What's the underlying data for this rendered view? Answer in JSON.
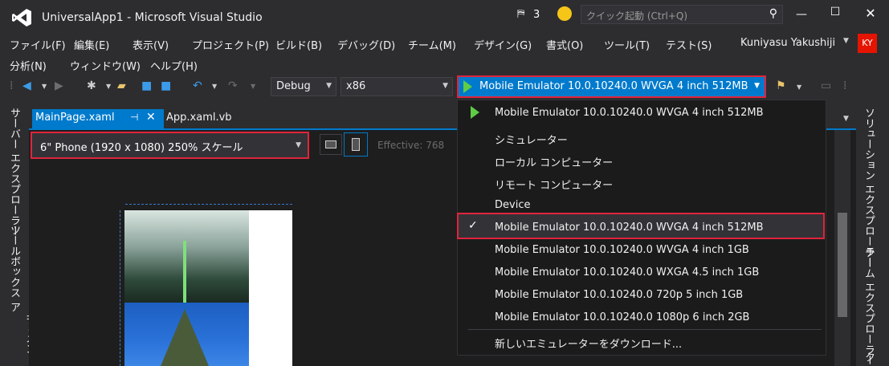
{
  "window": {
    "title": "UniversalApp1 - Microsoft Visual Studio",
    "notification_count": "3",
    "quick_launch_placeholder": "クイック起動 (Ctrl+Q)"
  },
  "menu": {
    "row1": [
      "ファイル(F)",
      "編集(E)",
      "表示(V)",
      "プロジェクト(P)",
      "ビルド(B)",
      "デバッグ(D)",
      "チーム(M)",
      "デザイン(G)",
      "書式(O)",
      "ツール(T)",
      "テスト(S)"
    ],
    "row2": [
      "分析(N)",
      "ウィンドウ(W)",
      "ヘルプ(H)"
    ],
    "user_name": "Kuniyasu Yakushiji",
    "user_initials": "KY"
  },
  "toolbar": {
    "config": "Debug",
    "platform": "x86",
    "target": "Mobile Emulator 10.0.10240.0 WVGA 4 inch 512MB"
  },
  "left_rail": {
    "items": [
      "サーバー エクスプローラー",
      "ツールボックス",
      "ドキュメント ア"
    ]
  },
  "right_rail": {
    "items": [
      "ソリューション エクスプローラー",
      "チーム エクスプローラー",
      "ク"
    ]
  },
  "tabs": [
    {
      "label": "MainPage.xaml",
      "active": true
    },
    {
      "label": "App.xaml.vb",
      "active": false
    }
  ],
  "designer": {
    "device": "6\" Phone (1920 x 1080) 250% スケール",
    "effective": "Effective: 768"
  },
  "dropdown": {
    "top_item": "Mobile Emulator 10.0.10240.0 WVGA 4 inch 512MB",
    "items": [
      "シミュレーター",
      "ローカル コンピューター",
      "リモート コンピューター",
      "Device",
      "Mobile Emulator 10.0.10240.0 WVGA 4 inch 512MB",
      "Mobile Emulator 10.0.10240.0 WVGA 4 inch 1GB",
      "Mobile Emulator 10.0.10240.0 WXGA 4.5 inch 1GB",
      "Mobile Emulator 10.0.10240.0 720p 5 inch 1GB",
      "Mobile Emulator 10.0.10240.0 1080p 6 inch 2GB"
    ],
    "selected_index": 4,
    "download_label": "新しいエミュレーターをダウンロード..."
  },
  "colors": {
    "accent": "#007acc",
    "highlight_border": "#e0243c",
    "background": "#2d2d30"
  }
}
